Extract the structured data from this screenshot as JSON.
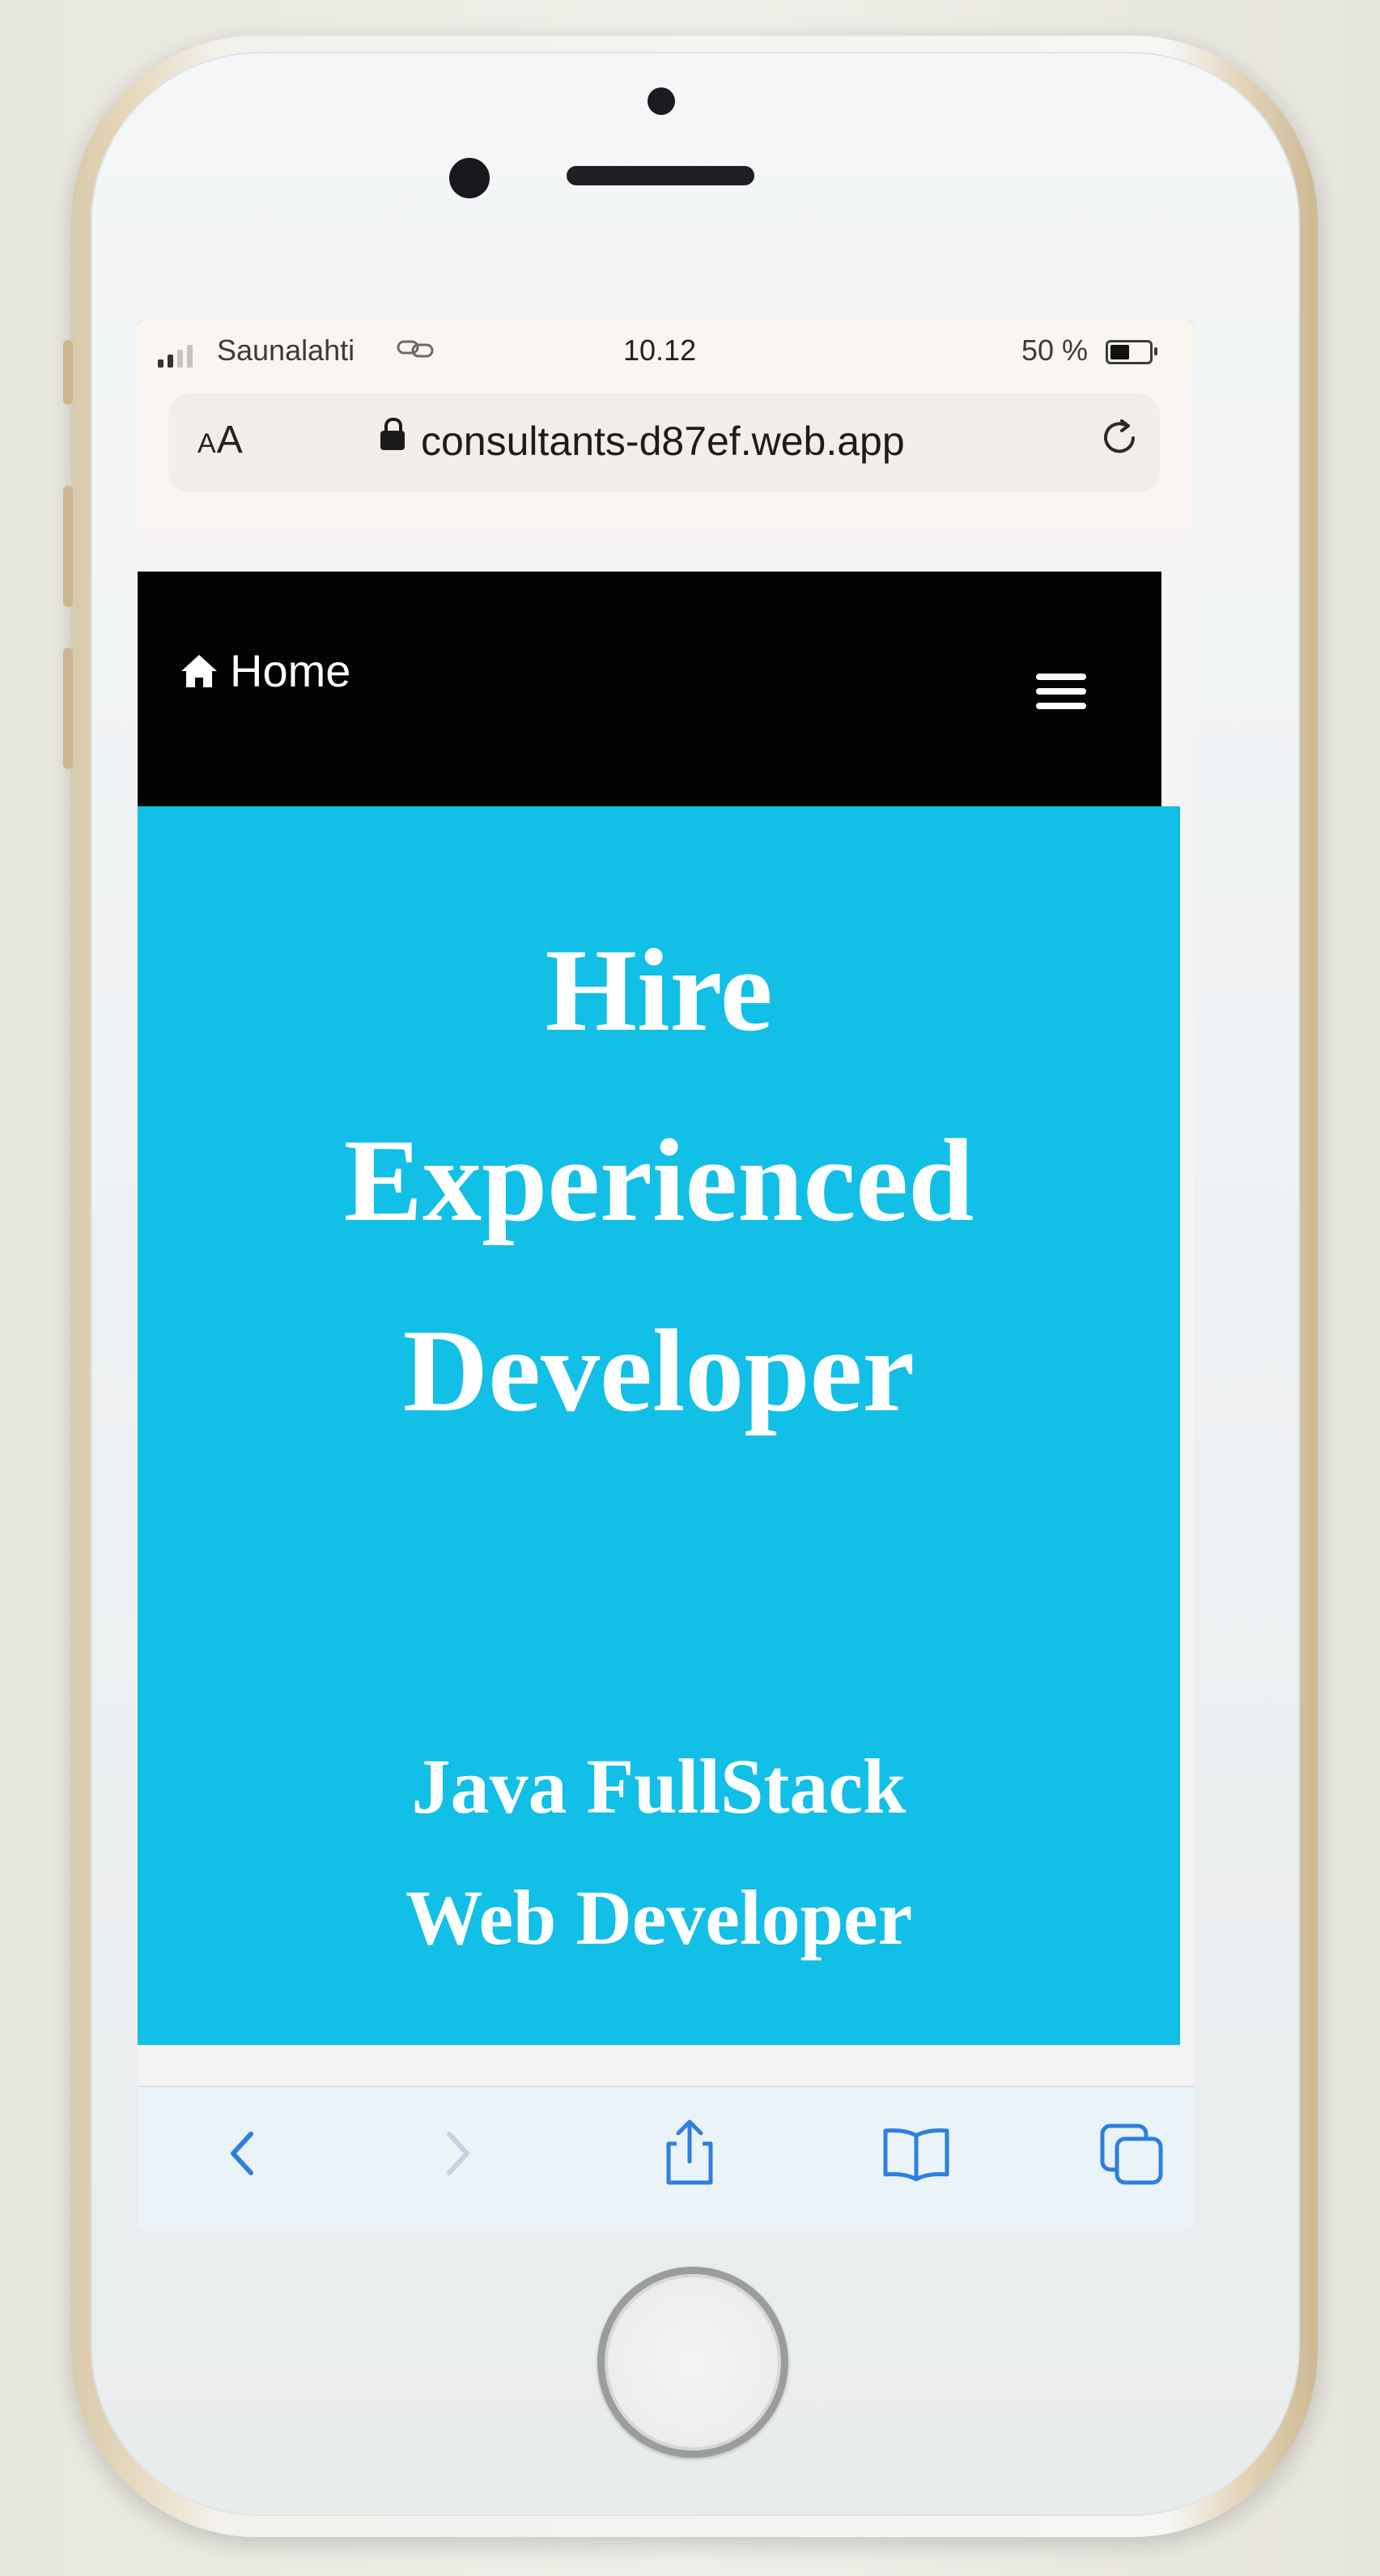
{
  "status_bar": {
    "carrier": "Saunalahti",
    "time": "10.12",
    "battery_percent_label": "50 %",
    "battery_level": 0.5,
    "signal_bars_filled": 2,
    "signal_bars_total": 4
  },
  "address_bar": {
    "text_size_label": "AA",
    "url": "consultants-d87ef.web.app",
    "secure": true
  },
  "navbar": {
    "home_label": "Home",
    "home_icon": "house-icon",
    "menu_icon": "hamburger-icon"
  },
  "hero": {
    "title_lines": [
      "Hire",
      "Experienced",
      "Developer"
    ],
    "subtitle_lines": [
      "Java FullStack",
      "Web Developer"
    ],
    "background_color": "#12bfe6",
    "text_color": "#ffffff"
  },
  "toolbar": {
    "buttons": [
      {
        "icon": "back-chevron-icon",
        "enabled": true
      },
      {
        "icon": "forward-chevron-icon",
        "enabled": false
      },
      {
        "icon": "share-icon",
        "enabled": true
      },
      {
        "icon": "bookmarks-book-icon",
        "enabled": true
      },
      {
        "icon": "tabs-icon",
        "enabled": true
      }
    ],
    "accent_color": "#2d7fe0"
  }
}
